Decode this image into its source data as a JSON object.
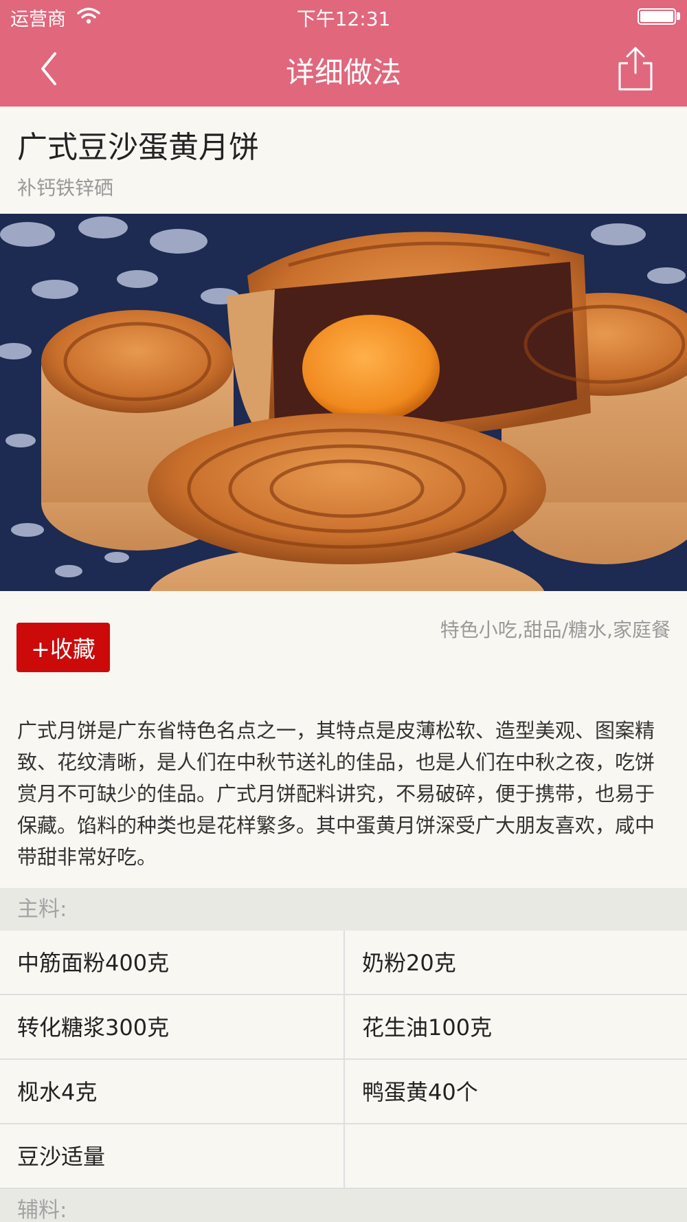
{
  "status": {
    "carrier": "运营商",
    "time": "下午12:31"
  },
  "nav": {
    "title": "详细做法",
    "back_icon": "chevron-left-icon",
    "share_icon": "share-icon"
  },
  "recipe": {
    "title": "广式豆沙蛋黄月饼",
    "subtitle": "补钙铁锌硒",
    "image_alt": "mooncake photo",
    "favorite_label": "+收藏",
    "tags": "特色小吃,甜品/糖水,家庭餐",
    "description": "广式月饼是广东省特色名点之一，其特点是皮薄松软、造型美观、图案精致、花纹清晰，是人们在中秋节送礼的佳品，也是人们在中秋之夜，吃饼赏月不可缺少的佳品。广式月饼配料讲究，不易破碎，便于携带，也易于保藏。馅料的种类也是花样繁多。其中蛋黄月饼深受广大朋友喜欢，咸中带甜非常好吃。"
  },
  "main_ingredients": {
    "label": "主料:",
    "rows": [
      [
        "中筋面粉400克",
        "奶粉20克"
      ],
      [
        "转化糖浆300克",
        "花生油100克"
      ],
      [
        "枧水4克",
        "鸭蛋黄40个"
      ],
      [
        "豆沙适量",
        ""
      ]
    ]
  },
  "secondary_ingredients": {
    "label": "辅料:"
  },
  "colors": {
    "nav_bg": "#e0677c",
    "fav_button": "#cc0a0a",
    "page_bg": "#f8f7f2"
  }
}
